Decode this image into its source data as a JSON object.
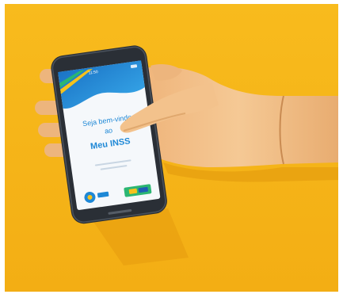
{
  "image": {
    "description_colors": {
      "background": "#F6B518",
      "background_shadow": "#E69E0F",
      "hand": "#F2C08A",
      "hand_shadow": "#D99A5E",
      "phone_body": "#2A2F36",
      "screen_top_blue": "#1E88D6",
      "screen_bg": "#F5F8FB",
      "text_blue": "#1E88D6",
      "accent_green": "#2BB673",
      "accent_yellow": "#F6C21C"
    },
    "phone_screen": {
      "welcome_text_line1": "Seja bem-vindo",
      "welcome_text_line2": "ao",
      "app_name": "Meu INSS",
      "status_time": "11:50"
    }
  }
}
